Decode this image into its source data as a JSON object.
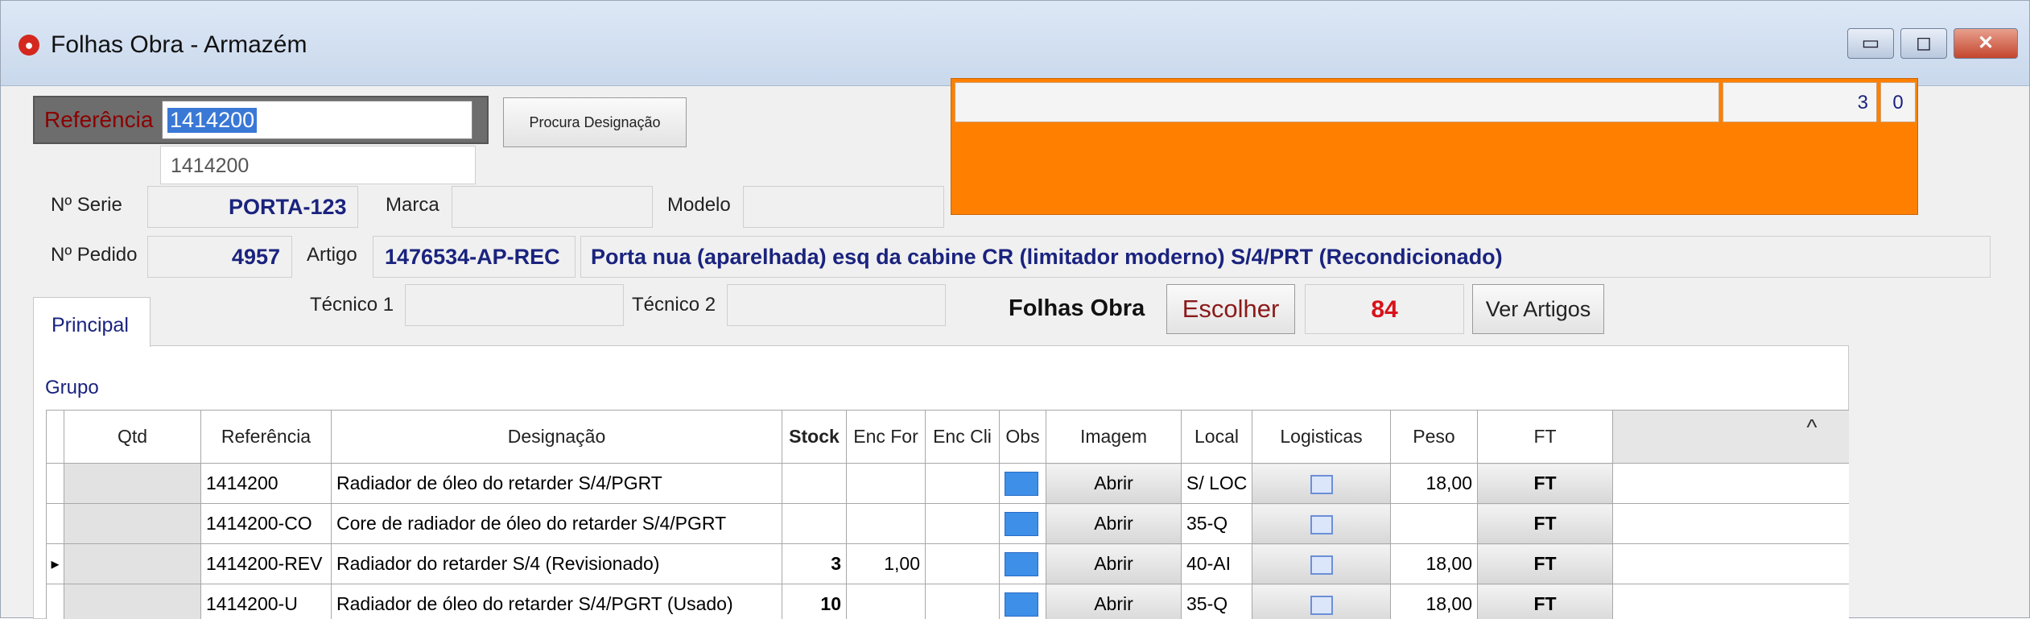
{
  "window": {
    "title": "Folhas Obra - Armazém",
    "app_icon": "red-circle-app-icon",
    "controls": {
      "minimize": "▭",
      "maximize": "◻",
      "close": "✕"
    }
  },
  "form": {
    "referencia_label": "Referência",
    "referencia_value": "1414200",
    "referencia_suggestion": "1414200",
    "procura_button": "Procura Designação",
    "serie_label": "Nº Serie",
    "serie_value": "PORTA-123",
    "marca_label": "Marca",
    "marca_value": "",
    "modelo_label": "Modelo",
    "modelo_value": "",
    "pedido_label": "Nº Pedido",
    "pedido_value": "4957",
    "artigo_label": "Artigo",
    "artigo_code": "1476534-AP-REC",
    "artigo_description": "Porta nua (aparelhada) esq da cabine CR (limitador moderno) S/4/PRT (Recondicionado)",
    "tecnico1_label": "Técnico 1",
    "tecnico1_value": "",
    "tecnico2_label": "Técnico 2",
    "tecnico2_value": ""
  },
  "status_panel": {
    "top_left": "",
    "top_mid": "3",
    "top_right": "0",
    "color": "#ff8000"
  },
  "folhas": {
    "label": "Folhas Obra",
    "escolher_button": "Escolher",
    "count": "84",
    "ver_artigos_button": "Ver Artigos"
  },
  "tabs": [
    {
      "label": "Principal"
    }
  ],
  "grupo_label": "Grupo",
  "grid": {
    "columns": {
      "qtd": "Qtd",
      "referencia": "Referência",
      "designacao": "Designação",
      "stock": "Stock",
      "enc_for": "Enc For",
      "enc_cli": "Enc Cli",
      "obs": "Obs",
      "imagem": "Imagem",
      "local": "Local",
      "logisticas": "Logisticas",
      "peso": "Peso",
      "ft": "FT"
    },
    "rows": [
      {
        "qtd": "",
        "referencia": "1414200",
        "designacao": "Radiador de óleo do retarder  S/4/PGRT",
        "stock": "",
        "enc_for": "",
        "enc_cli": "",
        "imagem": "Abrir",
        "local": "S/ LOC",
        "peso": "18,00",
        "ft": "FT"
      },
      {
        "qtd": "",
        "referencia": "1414200-CO",
        "designacao": "Core de radiador de óleo do retarder  S/4/PGRT",
        "stock": "",
        "enc_for": "",
        "enc_cli": "",
        "imagem": "Abrir",
        "local": "35-Q",
        "peso": "",
        "ft": "FT"
      },
      {
        "qtd": "",
        "referencia": "1414200-REV",
        "designacao": "Radiador do retarder  S/4 (Revisionado)",
        "stock": "3",
        "enc_for": "1,00",
        "enc_cli": "",
        "imagem": "Abrir",
        "local": "40-AI",
        "peso": "18,00",
        "ft": "FT"
      },
      {
        "qtd": "",
        "referencia": "1414200-U",
        "designacao": "Radiador de óleo do retarder S/4/PGRT (Usado)",
        "stock": "10",
        "enc_for": "",
        "enc_cli": "",
        "imagem": "Abrir",
        "local": "35-Q",
        "peso": "18,00",
        "ft": "FT"
      }
    ],
    "current_row_marker": "▸",
    "scroll_up": "^"
  }
}
